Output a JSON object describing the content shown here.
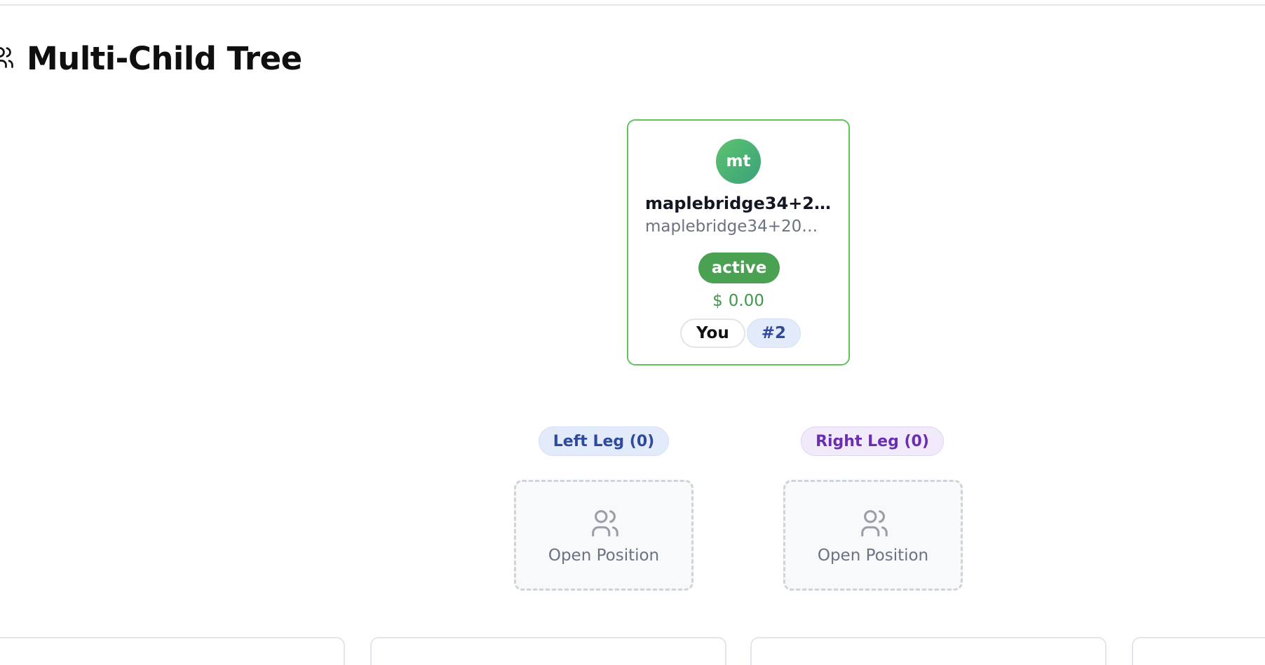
{
  "page": {
    "title": "Multi-Child Tree",
    "icon": "users-icon"
  },
  "root_member": {
    "initials": "mt",
    "name": "maplebridge34+20 ...",
    "email": "maplebridge34+20@g...",
    "status": "active",
    "currency": "$",
    "balance": "0.00",
    "you_tag": "You",
    "rank_tag": "#2"
  },
  "legs": {
    "left": {
      "label": "Left Leg (0)",
      "slot_label": "Open Position",
      "slot_icon": "users-icon"
    },
    "right": {
      "label": "Right Leg (0)",
      "slot_label": "Open Position",
      "slot_icon": "users-icon"
    }
  },
  "colors": {
    "root_border": "#5cc55c",
    "status_active": "#4aa152",
    "balance_text": "#3e9a48",
    "left_leg_text": "#2e4a9c",
    "right_leg_text": "#6a2fb0"
  }
}
